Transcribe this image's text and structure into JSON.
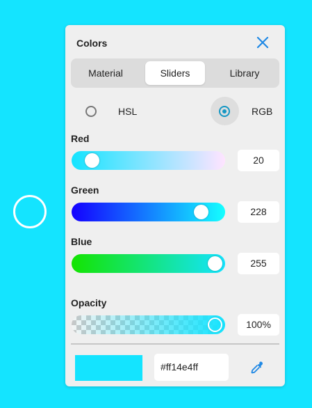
{
  "panel": {
    "title": "Colors"
  },
  "tabs": [
    {
      "label": "Material",
      "active": false
    },
    {
      "label": "Sliders",
      "active": true
    },
    {
      "label": "Library",
      "active": false
    }
  ],
  "mode": {
    "options": [
      {
        "label": "HSL",
        "selected": false
      },
      {
        "label": "RGB",
        "selected": true
      }
    ]
  },
  "channels": {
    "red": {
      "label": "Red",
      "value": "20"
    },
    "green": {
      "label": "Green",
      "value": "228"
    },
    "blue": {
      "label": "Blue",
      "value": "255"
    },
    "opacity": {
      "label": "Opacity",
      "value": "100%"
    }
  },
  "hex": {
    "value": "#ff14e4ff"
  },
  "colors": {
    "current": "#14e4ff",
    "accent": "#1597c4",
    "close_icon": "#1e88e5"
  },
  "icons": [
    "close-icon",
    "eyedropper-icon"
  ]
}
